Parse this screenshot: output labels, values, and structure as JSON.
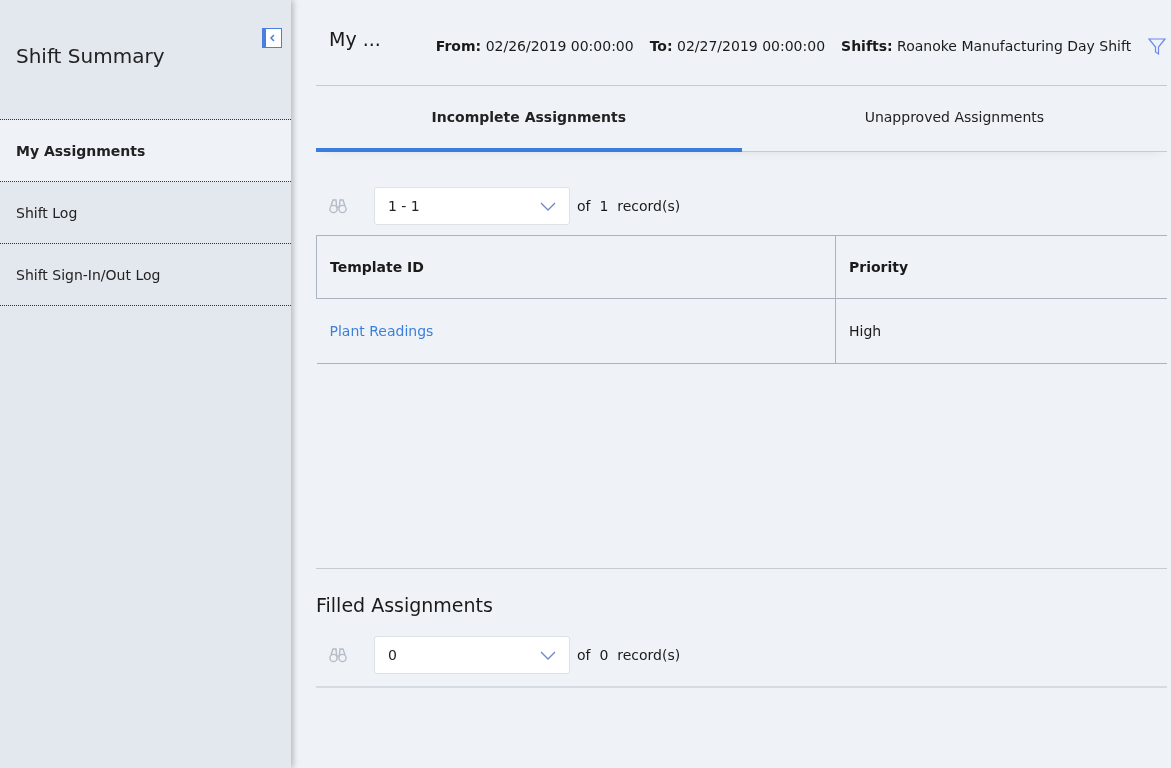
{
  "sidebar": {
    "title": "Shift Summary",
    "items": [
      {
        "label": "My Assignments",
        "selected": true
      },
      {
        "label": "Shift Log",
        "selected": false
      },
      {
        "label": "Shift Sign-In/Out Log",
        "selected": false
      }
    ]
  },
  "header": {
    "title": "My ...",
    "fields": [
      "**From:** 02/26/2019 00:00:00",
      "**To:** 02/27/2019 00:00:00",
      "**Shifts:** Roanoke Manufacturing Day Shift"
    ]
  },
  "tabs": [
    {
      "label": "Incomplete Assignments",
      "selected": true
    },
    {
      "label": "Unapproved Assignments",
      "selected": false
    }
  ],
  "incomplete": {
    "pager": {
      "value": "1 - 1",
      "summary": "of  1  record(s)"
    },
    "table": {
      "columns": [
        "Template ID",
        "Priority"
      ],
      "rows": [
        [
          "Plant Readings",
          "High"
        ]
      ]
    }
  },
  "filled": {
    "title": "Filled Assignments",
    "pager": {
      "value": "0",
      "summary": "of  0  record(s)"
    }
  }
}
